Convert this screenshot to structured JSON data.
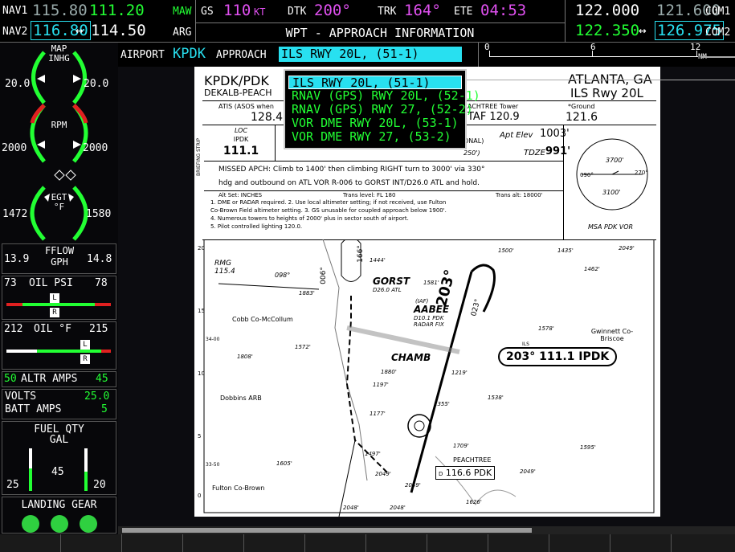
{
  "top": {
    "nav1_label": "NAV1",
    "nav1_standby": "115.80",
    "nav1_active": "111.20",
    "nav1_ident": "MAW",
    "nav2_label": "NAV2",
    "nav2_active": "116.80",
    "nav2_arrow": "↔",
    "nav2_standby": "114.50",
    "nav2_ident": "ARG",
    "gs_label": "GS",
    "gs_value": "110",
    "gs_unit": "KT",
    "dtk_label": "DTK",
    "dtk_value": "200°",
    "trk_label": "TRK",
    "trk_value": "164°",
    "ete_label": "ETE",
    "ete_value": "04:53",
    "page_title": "WPT - APPROACH INFORMATION",
    "com1_active": "122.000",
    "com1_standby": "121.600",
    "com1_label": "COM1",
    "com2_active": "122.350",
    "com2_arrow": "↔",
    "com2_standby": "126.975",
    "com2_label": "COM2"
  },
  "selector": {
    "airport_label": "AIRPORT",
    "airport_value": "KPDK",
    "approach_label": "APPROACH",
    "approach_value": "ILS RWY 20L, (51-1)"
  },
  "scale": {
    "t0": "0",
    "t1": "6",
    "t2": "12",
    "unit": "NM"
  },
  "approach_list": [
    "ILS RWY 20L, (51-1)",
    "RNAV (GPS) RWY 20L, (52-1)",
    "RNAV (GPS) RWY 27, (52-2)",
    "VOR DME RWY 20L, (53-1)",
    "VOR DME RWY 27, (53-2)"
  ],
  "eis": {
    "map_label": "MAP",
    "inhg_label": "INHG",
    "map_left": "20.0",
    "map_right": "20.0",
    "rpm_label": "RPM",
    "rpm_left": "2000",
    "rpm_right": "2000",
    "egt_label": "EGT",
    "egt_unit": "°F",
    "egt_left": "1472",
    "egt_right": "1580",
    "fflow_left": "13.9",
    "fflow_label": "FFLOW",
    "fflow_unit": "GPH",
    "fflow_right": "14.8",
    "oilpsi_left": "73",
    "oilpsi_label": "OIL PSI",
    "oilpsi_right": "78",
    "oilf_left": "212",
    "oilf_label": "OIL °F",
    "oilf_right": "215",
    "altr_left": "50",
    "altr_label": "ALTR AMPS",
    "altr_right": "45",
    "volts_label": "VOLTS",
    "volts_value": "25.0",
    "batt_label": "BATT AMPS",
    "batt_value": "5",
    "fuel_label": "FUEL QTY",
    "fuel_unit": "GAL",
    "fuel_left": "25",
    "fuel_mid": "45",
    "fuel_right": "20",
    "gear_label": "LANDING GEAR",
    "l_marker": "L",
    "r_marker": "R"
  },
  "plate": {
    "ident": "KPDK/PDK",
    "name": "DEKALB-PEACH",
    "city": "ATLANTA, GA",
    "procedure": "ILS Rwy 20L",
    "atis_label": "ATIS (ASOS when",
    "atis_freq": "128.4",
    "tower_label": "ACHTREE Tower",
    "tower_freq": "TAF 120.9",
    "ground_label": "*Ground",
    "ground_freq": "121.6",
    "loc_label": "LOC",
    "loc_ident": "IPDK",
    "loc_freq": "111.1",
    "apt_elev_label": "Apt Elev",
    "apt_elev": "1003'",
    "tdze_label": "TDZE",
    "tdze": "991'",
    "onal": "ONAL)",
    "h250": "250')",
    "strip": "BRIEFING STRIP",
    "missed": "MISSED APCH: Climb to 1400' then climbing RIGHT turn to 3000' via 330°",
    "missed2": "hdg and outbound on ATL VOR R-006 to GORST INT/D26.0 ATL and hold.",
    "altset": "Alt Set: INCHES",
    "translevel": "Trans level: FL 180",
    "transalt": "Trans alt: 18000'",
    "note1": "1. DME or RADAR required. 2. Use local altimeter setting; if not received, use Fulton",
    "note2": "Co-Brown Field altimeter setting. 3. GS unusable for coupled approach below 1900'.",
    "note3": "4. Numerous towers to heights of 2000' plus in sector south of airport.",
    "note4": "5. Pilot controlled lighting 120.0.",
    "msa_label": "MSA PDK VOR",
    "msa_3700": "3700'",
    "msa_3100": "3100'",
    "msa_090": "090°",
    "msa_270": "270°",
    "gorst": "GORST",
    "gorst_sub": "D26.0 ATL",
    "aabee": "AABEE",
    "iaf": "(IAF)",
    "aabee_sub": "D10.1 PDK",
    "radar_fix": "RADAR FIX",
    "chamb": "CHAMB",
    "loc_box": "203° 111.1 IPDK",
    "ils_small": "ILS",
    "rmg": "RMG",
    "rmg_num": "115.4",
    "hdg_098": "098°",
    "hdg_006": "006°",
    "hdg_166": "166°",
    "hdg_203": "203°",
    "hdg_023": "023°",
    "hdg_330": "330°",
    "cobb": "Cobb Co-McCollum",
    "dobbins": "Dobbins ARB",
    "fulton": "Fulton Co-Brown",
    "gwinnett": "Gwinnett Co-Briscoe",
    "peachtree": "PEACHTREE",
    "pdk_freq": "116.6",
    "pdk_id": "PDK",
    "e1444": "1444'",
    "e1581": "1581'",
    "e1883": "1883'",
    "e1500": "1500'",
    "e1435": "1435'",
    "e2049": "2049'",
    "e1462": "1462'",
    "e1572": "1572'",
    "e1808": "1808'",
    "e1880": "1880'",
    "e1197": "1197'",
    "e1219": "1219'",
    "e1578": "1578'",
    "e1538": "1538'",
    "e1177": "1177'",
    "e1355": "1355'",
    "e1709": "1709'",
    "e1605": "1605'",
    "e1497": "1497'",
    "e2049b": "2049'",
    "e2049c": "2049'",
    "e2048": "2048'",
    "e2048b": "2048'",
    "e1626": "1626'",
    "e1595": "1595'",
    "e2049d": "2049'",
    "lat1": "34-00",
    "lat2": "33-50",
    "tick20": "20",
    "tick15": "15",
    "tick10": "10",
    "tick5": "5",
    "tick0": "0",
    "d_label": "D",
    "l_label": "L"
  }
}
